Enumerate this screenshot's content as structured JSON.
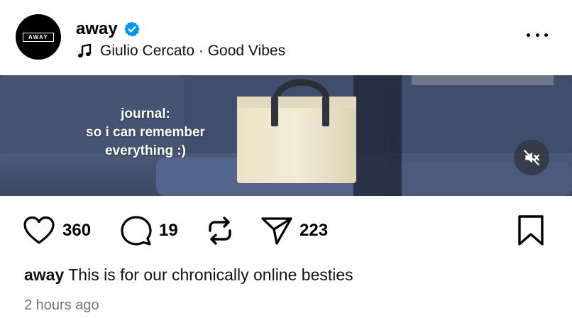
{
  "post": {
    "avatar_logo": "AWAY",
    "username": "away",
    "verified_icon": "verified-badge-icon",
    "audio": {
      "icon": "music-note-icon",
      "text": "Giulio Cercato · Good Vibes"
    },
    "more_icon": "more-options-icon",
    "media": {
      "overlay_lines": [
        "journal:",
        "so i can remember",
        "everything :)"
      ],
      "mute_icon": "volume-muted-icon"
    },
    "actions": {
      "like_icon": "heart-icon",
      "likes": "360",
      "comment_icon": "comment-icon",
      "comments": "19",
      "repost_icon": "repost-icon",
      "share_icon": "send-icon",
      "shares": "223",
      "save_icon": "bookmark-icon"
    },
    "caption": {
      "username": "away",
      "text": "This is for our chronically online besties"
    },
    "timestamp": "2 hours ago"
  },
  "colors": {
    "verified_blue": "#0095f6",
    "timestamp_gray": "#737373"
  }
}
